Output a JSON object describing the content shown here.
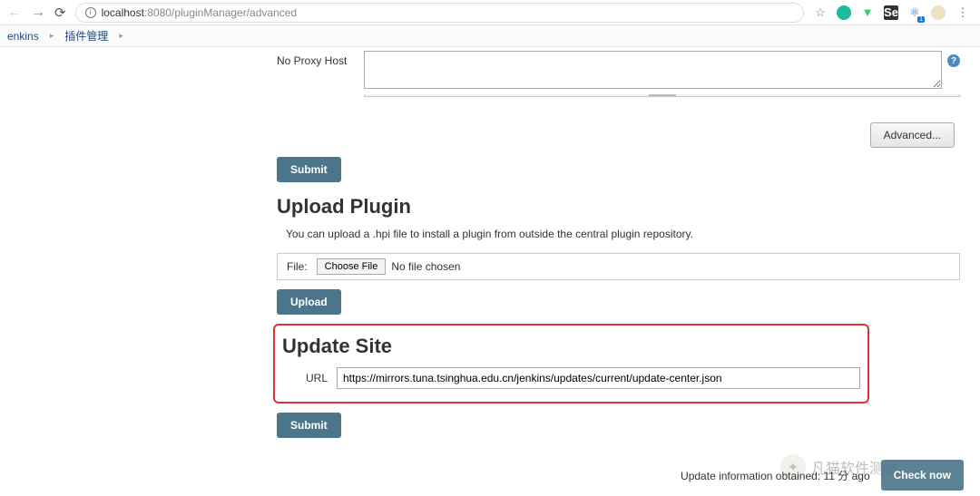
{
  "browser": {
    "url_host": "localhost",
    "url_rest": ":8080/pluginManager/advanced"
  },
  "breadcrumb": {
    "item1": "enkins",
    "item2": "插件管理"
  },
  "proxy": {
    "no_proxy_label": "No Proxy Host",
    "advanced_btn": "Advanced...",
    "submit_btn": "Submit"
  },
  "upload": {
    "heading": "Upload Plugin",
    "desc": "You can upload a .hpi file to install a plugin from outside the central plugin repository.",
    "file_label": "File:",
    "choose_btn": "Choose File",
    "no_file": "No file chosen",
    "upload_btn": "Upload"
  },
  "update_site": {
    "heading": "Update Site",
    "url_label": "URL",
    "url_value": "https://mirrors.tuna.tsinghua.edu.cn/jenkins/updates/current/update-center.json",
    "submit_btn": "Submit"
  },
  "footer": {
    "info": "Update information obtained: 11 分 ago",
    "check_btn": "Check now"
  },
  "watermark": {
    "text": "凡猫软件测试"
  }
}
